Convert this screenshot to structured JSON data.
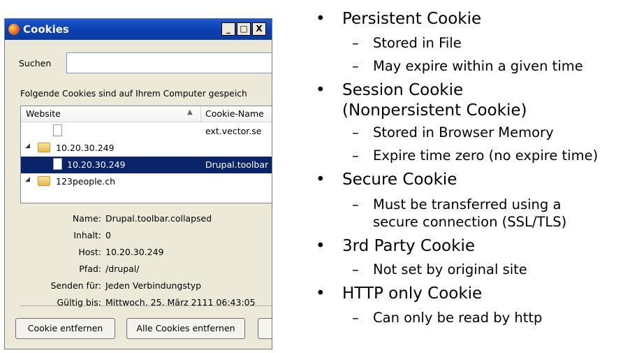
{
  "window": {
    "title": "Cookies",
    "buttons": {
      "minimize": "_",
      "maximize": "□",
      "close": "X"
    }
  },
  "search": {
    "label": "Suchen",
    "value": ""
  },
  "info_label": "Folgende Cookies sind auf Ihrem Computer gespeich",
  "list": {
    "columns": [
      "Website",
      "Cookie-Name"
    ],
    "rows": [
      {
        "site": "",
        "cookie": "ext.vector.se",
        "type": "cookie"
      },
      {
        "site": "10.20.30.249",
        "cookie": "",
        "type": "folder"
      },
      {
        "site": "10.20.30.249",
        "cookie": "Drupal.toolbar",
        "type": "cookie",
        "selected": true
      },
      {
        "site": "123people.ch",
        "cookie": "",
        "type": "folder"
      }
    ]
  },
  "details": [
    {
      "key": "Name:",
      "value": "Drupal.toolbar.collapsed"
    },
    {
      "key": "Inhalt:",
      "value": "0"
    },
    {
      "key": "Host:",
      "value": "10.20.30.249"
    },
    {
      "key": "Pfad:",
      "value": "/drupal/"
    },
    {
      "key": "Senden für:",
      "value": "Jeden Verbindungstyp"
    },
    {
      "key": "Gültig bis:",
      "value": "Mittwoch, 25. März 2111 06:43:05"
    }
  ],
  "buttons": {
    "remove_cookie": "Cookie entfernen",
    "remove_all": "Alle Cookies entfernen",
    "close": ""
  },
  "slide": {
    "items": [
      {
        "title": "Persistent Cookie",
        "subs": [
          "Stored in File",
          "May expire within a given time"
        ]
      },
      {
        "title": "Session Cookie",
        "title2": "(Nonpersistent Cookie)",
        "subs": [
          "Stored in Browser Memory",
          "Expire time zero (no expire time)"
        ]
      },
      {
        "title": "Secure Cookie",
        "subs": [
          "Must be transferred using a",
          "secure connection (SSL/TLS)"
        ]
      },
      {
        "title": "3rd Party Cookie",
        "subs": [
          "Not set by original site"
        ]
      },
      {
        "title": "HTTP only Cookie",
        "subs": [
          "Can only be read by http"
        ]
      }
    ]
  }
}
